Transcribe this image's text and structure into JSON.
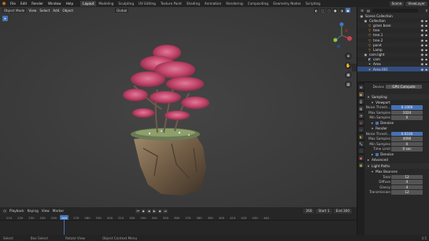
{
  "menu": {
    "items": [
      "File",
      "Edit",
      "Render",
      "Window",
      "Help"
    ]
  },
  "workspaces": [
    "Layout",
    "Modeling",
    "Sculpting",
    "UV Editing",
    "Texture Paint",
    "Shading",
    "Animation",
    "Rendering",
    "Compositing",
    "Geometry Nodes",
    "Scripting"
  ],
  "active_workspace": "Layout",
  "scene": {
    "name": "Scene",
    "layer": "ViewLayer"
  },
  "viewport_header": {
    "mode": "Object Mode",
    "menus": [
      "View",
      "Select",
      "Add",
      "Object"
    ],
    "orientation": "Global"
  },
  "timeline": {
    "menus": [
      "Playback",
      "Keying",
      "View",
      "Marker"
    ],
    "current_frame": "260",
    "start_label": "Start",
    "start": "1",
    "end_label": "End",
    "end": "300",
    "ticks": [
      "210",
      "220",
      "230",
      "240",
      "250",
      "260",
      "270",
      "280",
      "290",
      "300",
      "310",
      "320",
      "330",
      "340",
      "350",
      "360",
      "370",
      "380",
      "390",
      "400",
      "410",
      "420",
      "430",
      "440"
    ]
  },
  "status": {
    "items": [
      "Select",
      "Box Select",
      "Rotate View",
      "Object Context Menu"
    ],
    "version": "3.5"
  },
  "outliner": {
    "rows": [
      {
        "label": "Scene Collection",
        "icon": "collection-icon",
        "color": "#bbbbbb",
        "indent": 0
      },
      {
        "label": "Collection",
        "icon": "collection-icon",
        "color": "#bbbbbb",
        "indent": 1
      },
      {
        "label": "grass base",
        "icon": "object-icon",
        "color": "#e8a24a",
        "indent": 2
      },
      {
        "label": "tree",
        "icon": "object-icon",
        "color": "#e8a24a",
        "indent": 2
      },
      {
        "label": "tree.1",
        "icon": "object-icon",
        "color": "#e8a24a",
        "indent": 2
      },
      {
        "label": "tree.2",
        "icon": "object-icon",
        "color": "#e8a24a",
        "indent": 2
      },
      {
        "label": "pond",
        "icon": "object-icon",
        "color": "#e8a24a",
        "indent": 2
      },
      {
        "label": "Lamp",
        "icon": "object-icon",
        "color": "#e8a24a",
        "indent": 2
      },
      {
        "label": "cam.light",
        "icon": "collection-icon",
        "color": "#bbbbbb",
        "indent": 1
      },
      {
        "label": "cam",
        "icon": "camera-icon",
        "color": "#8fb3d9",
        "indent": 2
      },
      {
        "label": "Area",
        "icon": "light-icon",
        "color": "#e8c84a",
        "indent": 2
      },
      {
        "label": "Area.001",
        "icon": "light-icon",
        "color": "#e8c84a",
        "indent": 2
      }
    ]
  },
  "properties": {
    "device_label": "Device",
    "device_value": "GPU Compute",
    "sampling_title": "Sampling",
    "viewport_title": "Viewport",
    "viewport_rows": [
      {
        "label": "Noise Thresh...",
        "value": "0.1000",
        "highlight": true
      },
      {
        "label": "Max Samples",
        "value": "1024",
        "highlight": false
      },
      {
        "label": "Min Samples",
        "value": "0",
        "highlight": false
      }
    ],
    "denoise_label": "Denoise",
    "render_title": "Render",
    "render_rows": [
      {
        "label": "Noise Thresh...",
        "value": "0.0100",
        "highlight": true
      },
      {
        "label": "Max Samples",
        "value": "4096",
        "highlight": false
      },
      {
        "label": "Min Samples",
        "value": "0",
        "highlight": false
      },
      {
        "label": "Time Limit",
        "value": "0 sec",
        "highlight": false
      }
    ],
    "render_denoise_label": "Denoise",
    "advanced_title": "Advanced",
    "lightpaths_title": "Light Paths",
    "maxbounces_title": "Max Bounces",
    "bounce_rows": [
      {
        "label": "Total",
        "value": "12"
      },
      {
        "label": "Diffuse",
        "value": "4"
      },
      {
        "label": "Glossy",
        "value": "4"
      },
      {
        "label": "Transmission",
        "value": "12"
      }
    ]
  },
  "colors": {
    "accent": "#4772b3",
    "foliage": "#c74a6e",
    "rock": "#8b7355"
  }
}
